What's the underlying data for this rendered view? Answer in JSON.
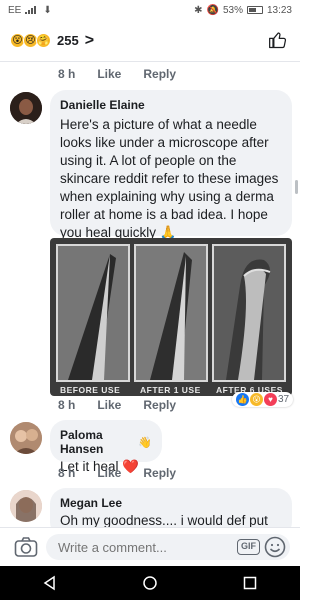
{
  "status_bar": {
    "carrier": "EE",
    "battery": "53%",
    "time": "13:23"
  },
  "header": {
    "reaction_count": "255",
    "chevron": ">"
  },
  "comments": [
    {
      "name": "Danielle Elaine",
      "text": "Here's a picture of what a needle looks like under a microscope after using it. A lot of people on the skincare reddit refer to these images when explaining why using a derma roller at home is a bad idea. I hope you heal quickly 🙏",
      "time": "8 h",
      "like": "Like",
      "reply": "Reply",
      "image_labels": [
        "BEFORE USE",
        "AFTER 1 USE",
        "AFTER 6 USES"
      ],
      "reaction_count": "37"
    },
    {
      "name": "Paloma Hansen",
      "text": "Let it heal ❤️",
      "time": "8 h",
      "like": "Like",
      "reply": "Reply"
    },
    {
      "name": "Megan Lee",
      "text": "Oh my goodness.... i would def put"
    }
  ],
  "previous_meta": {
    "time": "8 h",
    "like": "Like",
    "reply": "Reply"
  },
  "composer": {
    "placeholder": "Write a comment...",
    "gif": "GIF"
  },
  "colors": {
    "bubble": "#f0f2f5",
    "meta": "#606770",
    "like_blue": "#1877f2",
    "love_red": "#f33e58",
    "wow_yellow": "#f7b928"
  }
}
